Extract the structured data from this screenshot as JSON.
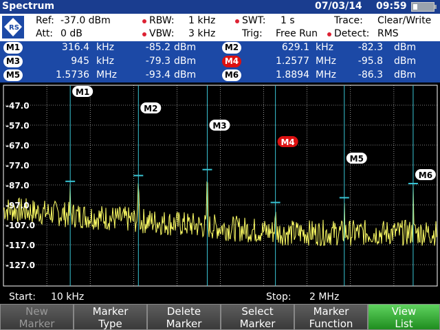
{
  "title_bar": {
    "mode": "Spectrum",
    "date": "07/03/14",
    "time": "09:59",
    "battery_icon": "battery-icon"
  },
  "settings": {
    "ref": "Ref:",
    "ref_value": "-37.0 dBm",
    "att": "Att:",
    "att_value": "0 dB",
    "rbw": "RBW:",
    "rbw_value": "1 kHz",
    "vbw": "VBW:",
    "vbw_value": "3 kHz",
    "swt": "SWT:",
    "swt_value": "1 s",
    "trig": "Trig:",
    "trig_value": "Free Run",
    "trace": "Trace:",
    "trace_value": "Clear/Write",
    "detect": "Detect:",
    "detect_value": "RMS"
  },
  "markers": [
    {
      "id": "M1",
      "freq": "316.4",
      "unit": "kHz",
      "level": "-85.2",
      "level_unit": "dBm",
      "active": false
    },
    {
      "id": "M2",
      "freq": "629.1",
      "unit": "kHz",
      "level": "-82.3",
      "level_unit": "dBm",
      "active": false
    },
    {
      "id": "M3",
      "freq": "945",
      "unit": "kHz",
      "level": "-79.3",
      "level_unit": "dBm",
      "active": false
    },
    {
      "id": "M4",
      "freq": "1.2577",
      "unit": "MHz",
      "level": "-95.8",
      "level_unit": "dBm",
      "active": true
    },
    {
      "id": "M5",
      "freq": "1.5736",
      "unit": "MHz",
      "level": "-93.4",
      "level_unit": "dBm",
      "active": false
    },
    {
      "id": "M6",
      "freq": "1.8894",
      "unit": "MHz",
      "level": "-86.3",
      "level_unit": "dBm",
      "active": false
    }
  ],
  "plot": {
    "y_ticks": [
      "-47.0",
      "-57.0",
      "-67.0",
      "-77.0",
      "-87.0",
      "-97.0",
      "-107.0",
      "-117.0",
      "-127.0"
    ],
    "colors": {
      "trace": "#ffff66",
      "grid": "#ffffff",
      "marker_line": "#39c6d6"
    }
  },
  "freq_bar": {
    "start_label": "Start:",
    "start_value": "10 kHz",
    "stop_label": "Stop:",
    "stop_value": "2 MHz"
  },
  "softkeys": [
    {
      "line1": "New",
      "line2": "Marker",
      "state": "disabled"
    },
    {
      "line1": "Marker",
      "line2": "Type",
      "state": "normal"
    },
    {
      "line1": "Delete",
      "line2": "Marker",
      "state": "normal"
    },
    {
      "line1": "Select",
      "line2": "Marker",
      "state": "normal"
    },
    {
      "line1": "Marker",
      "line2": "Function",
      "state": "normal"
    },
    {
      "line1": "View",
      "line2": "List",
      "state": "active"
    }
  ]
}
